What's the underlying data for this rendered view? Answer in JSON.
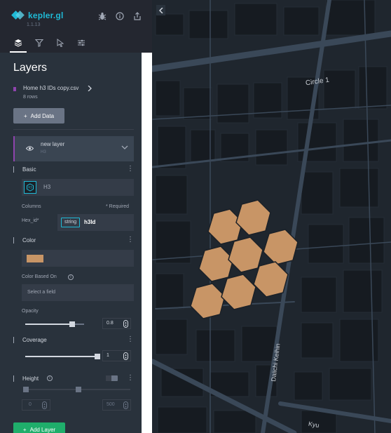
{
  "app": {
    "name": "kepler.gl",
    "version": "1.1.13",
    "header_actions": [
      "bug-icon",
      "info-icon",
      "share-icon"
    ],
    "tabs": [
      {
        "name": "layers",
        "icon": "layers-icon",
        "active": true
      },
      {
        "name": "filters",
        "icon": "filter-icon",
        "active": false
      },
      {
        "name": "interactions",
        "icon": "cursor-icon",
        "active": false
      },
      {
        "name": "map-style",
        "icon": "sliders-icon",
        "active": false
      }
    ]
  },
  "panel": {
    "title": "Layers",
    "dataset": {
      "name": "Home h3 IDs copy.csv",
      "rows": "8 rows",
      "color": "#8e44ad"
    },
    "add_data_label": "Add Data",
    "add_layer_label": "Add Layer"
  },
  "layer": {
    "name": "new layer",
    "type": "H3",
    "basic_label": "Basic",
    "layer_type_name": "H3",
    "columns_label": "Columns",
    "required_label": "* Required",
    "hex_id_label": "Hex_id*",
    "field_type": "string",
    "field_name": "h3Id",
    "color_label": "Color",
    "fill_color": "#c89566",
    "color_based_on_label": "Color Based On",
    "select_placeholder": "Select a field",
    "opacity_label": "Opacity",
    "opacity_value": "0.8",
    "opacity_fraction": 0.8,
    "coverage_label": "Coverage",
    "coverage_value": "1",
    "coverage_fraction": 1.0,
    "height_label": "Height",
    "height_enabled": false,
    "height_min": "0",
    "height_max": "500"
  },
  "map": {
    "street_labels": [
      "Circle 1",
      "Daiichi Keihin",
      "Kyu"
    ]
  },
  "colors": {
    "accent": "#1fbad6",
    "panel_bg": "#29323c",
    "header_bg": "#242730",
    "add_layer_green": "#1fae6b",
    "hex_fill": "#c89566"
  }
}
